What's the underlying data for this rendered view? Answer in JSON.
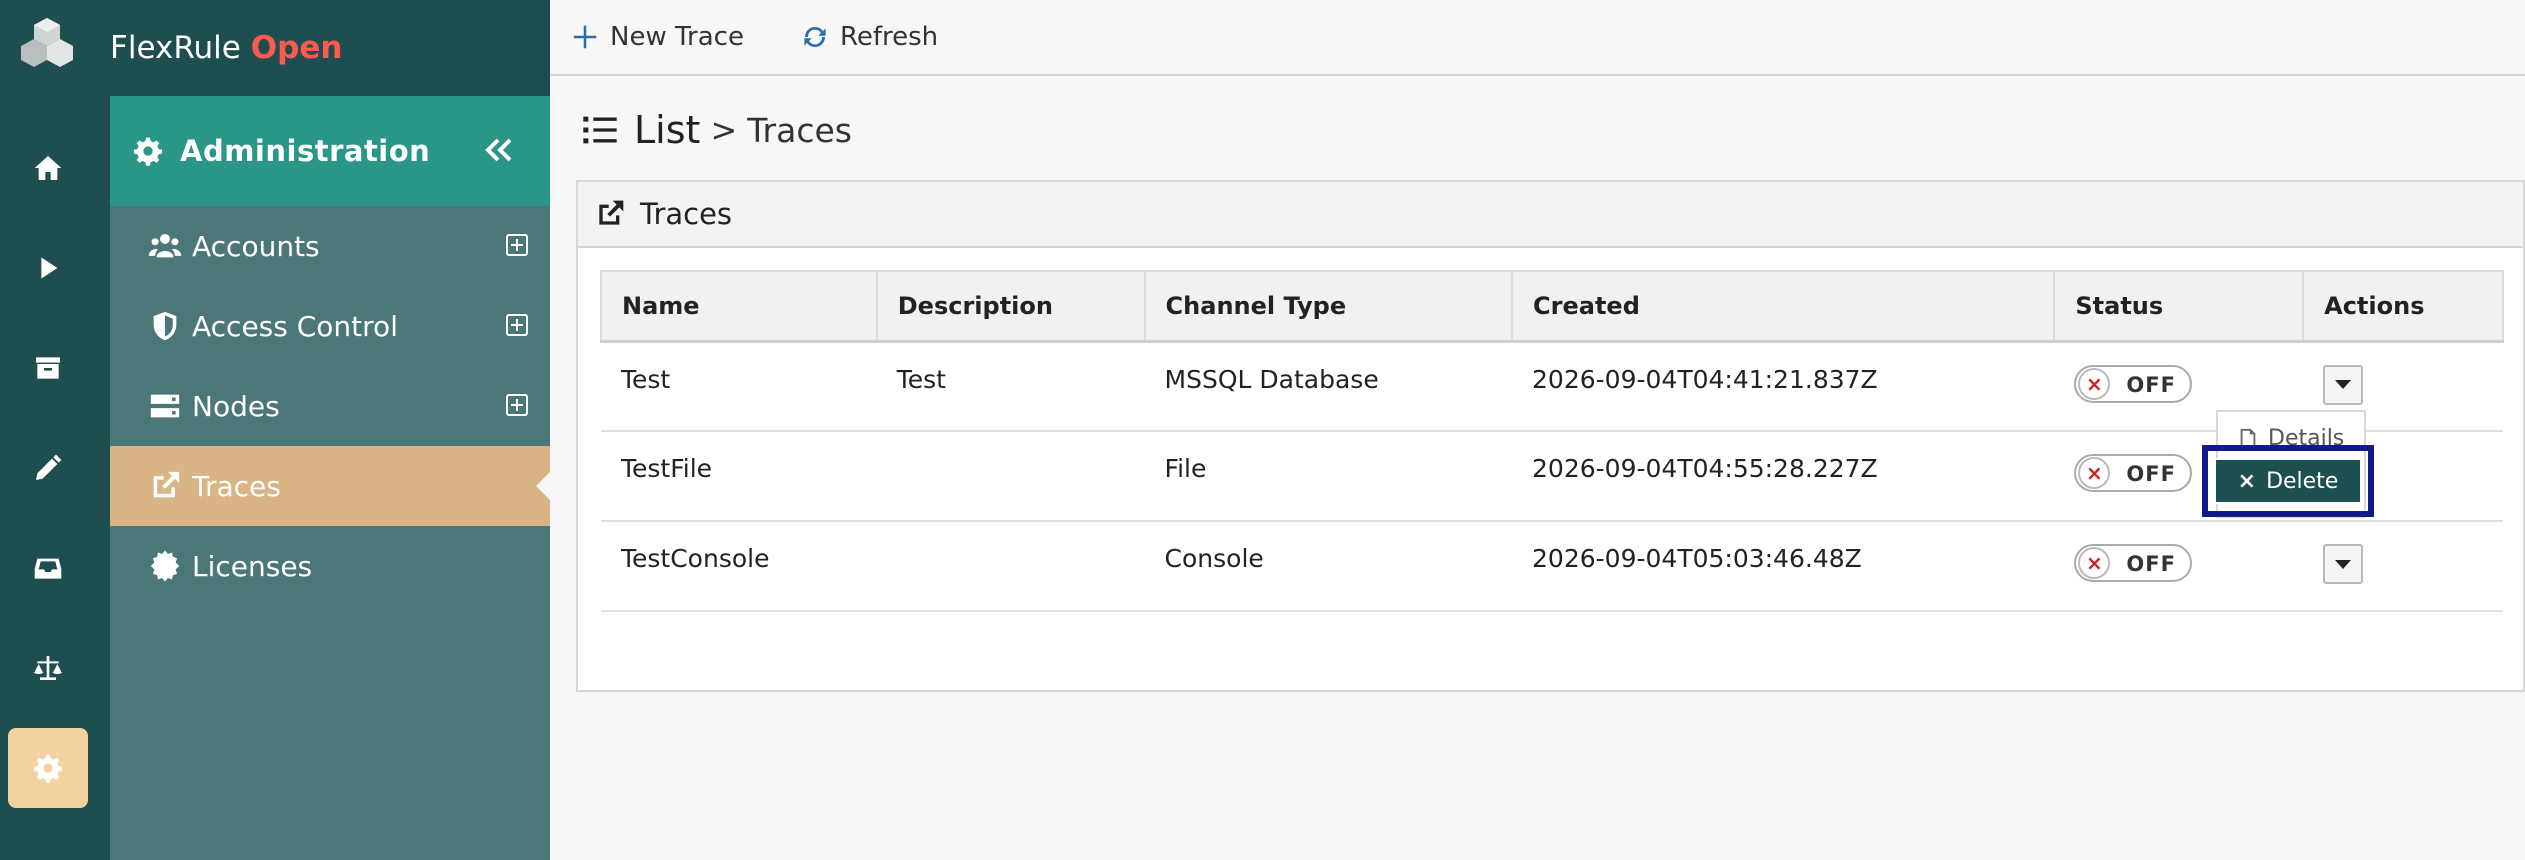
{
  "brand": {
    "name": "FlexRule",
    "suffix": "Open"
  },
  "rail": [
    "home-icon",
    "play-icon",
    "archive-icon",
    "pencil-icon",
    "inbox-icon",
    "scale-icon",
    "gear-icon"
  ],
  "sidebar": {
    "title": "Administration",
    "items": [
      {
        "label": "Accounts",
        "icon": "users-icon",
        "expandable": true
      },
      {
        "label": "Access Control",
        "icon": "shield-icon",
        "expandable": true
      },
      {
        "label": "Nodes",
        "icon": "server-icon",
        "expandable": true
      },
      {
        "label": "Traces",
        "icon": "external-link-icon",
        "expandable": false,
        "active": true
      },
      {
        "label": "Licenses",
        "icon": "certificate-icon",
        "expandable": false
      }
    ]
  },
  "toolbar": {
    "new_label": "New Trace",
    "refresh_label": "Refresh"
  },
  "page": {
    "list": "List",
    "separator": ">",
    "crumb": "Traces"
  },
  "panel": {
    "title": "Traces"
  },
  "table": {
    "headers": [
      "Name",
      "Description",
      "Channel Type",
      "Created",
      "Status",
      "Actions"
    ],
    "rows": [
      {
        "name": "Test",
        "description": "Test",
        "channel": "MSSQL Database",
        "created": "2026-09-04T04:41:21.837Z",
        "status": "OFF"
      },
      {
        "name": "TestFile",
        "description": "",
        "channel": "File",
        "created": "2026-09-04T04:55:28.227Z",
        "status": "OFF"
      },
      {
        "name": "TestConsole",
        "description": "",
        "channel": "Console",
        "created": "2026-09-04T05:03:46.48Z",
        "status": "OFF"
      }
    ]
  },
  "dropdown": {
    "details": "Details",
    "delete": "Delete",
    "delete_icon": "×"
  },
  "colors": {
    "rail": "#1f4e50",
    "sidebar": "#4b7778",
    "sidebar_head": "#2a9688",
    "active": "#d9b485",
    "brand_accent": "#ff5a4e",
    "highlight": "#121a8a"
  }
}
